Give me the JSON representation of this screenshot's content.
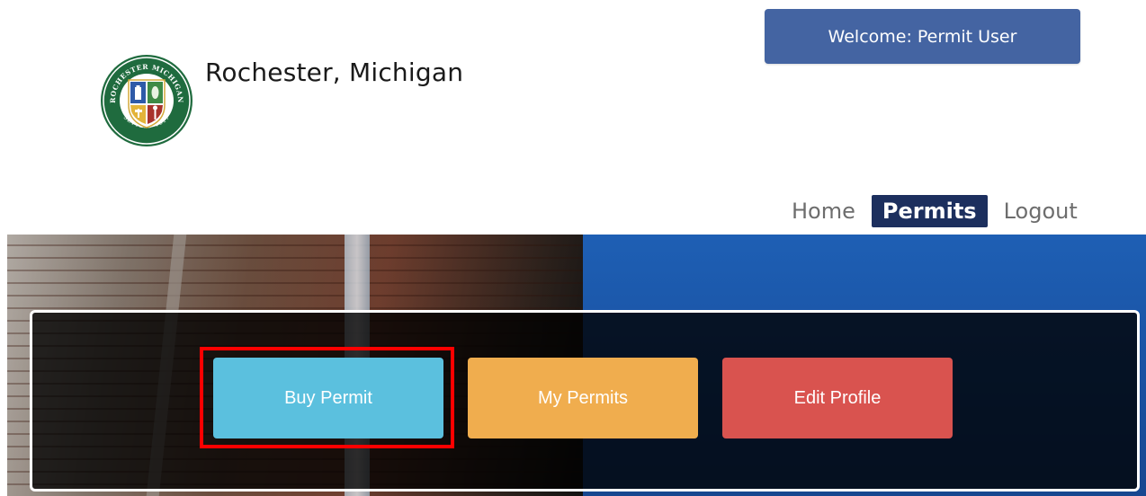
{
  "header": {
    "welcome_text": "Welcome:  Permit User",
    "org_name": "Rochester, Michigan",
    "logo": {
      "icon": "city-seal-icon",
      "ring_text_top": "ROCHESTER MICHIGAN",
      "ring_text_bottom": "SETTLED 1817",
      "colors": {
        "ring": "#1f6b3e",
        "blue": "#2e5aa8",
        "green": "#3e8a46",
        "yellow": "#e3b43a",
        "red": "#a8332c"
      }
    }
  },
  "nav": {
    "items": [
      {
        "label": "Home",
        "active": false
      },
      {
        "label": "Permits",
        "active": true
      },
      {
        "label": "Logout",
        "active": false
      }
    ]
  },
  "actions": {
    "buy_permit": "Buy Permit",
    "my_permits": "My Permits",
    "edit_profile": "Edit Profile"
  },
  "colors": {
    "welcome_bg": "#4464a2",
    "nav_active_bg": "#1c2f5e",
    "buy_permit": "#5bc0de",
    "my_permits": "#f0ad4e",
    "edit_profile": "#d9534f",
    "highlight": "#ff0000"
  }
}
